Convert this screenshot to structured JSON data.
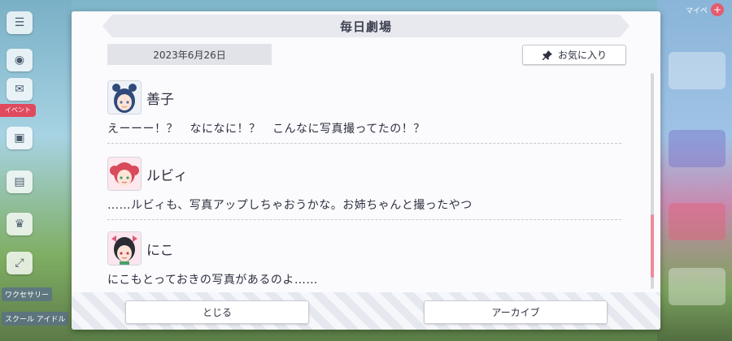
{
  "background": {
    "left_labels": [
      "ワクセサリー",
      "スクール\nアイドル"
    ],
    "event_tag": "イベント",
    "top_right_text": "マイペ"
  },
  "dialog": {
    "title": "毎日劇場",
    "date": "2023年6月26日",
    "favorite_label": "お気に入り",
    "messages": [
      {
        "speaker": "善子",
        "text": "えーーー！？　なになに！？　こんなに写真撮ってたの！？",
        "avatar_icon": "yoshiko-avatar",
        "avatar_color": "#2f4a7a"
      },
      {
        "speaker": "ルビィ",
        "text": "……ルビィも、写真アップしちゃおうかな。お姉ちゃんと撮ったやつ",
        "avatar_icon": "ruby-avatar",
        "avatar_color": "#d94a5a"
      },
      {
        "speaker": "にこ",
        "text": "にこもとっておきの写真があるのよ……",
        "avatar_icon": "nico-avatar",
        "avatar_color": "#2b2b33"
      }
    ],
    "close_label": "とじる",
    "archive_label": "アーカイブ"
  },
  "colors": {
    "accent_pink": "#f08a9a",
    "title_bar": "#e8e9ef",
    "text": "#2d3040"
  }
}
